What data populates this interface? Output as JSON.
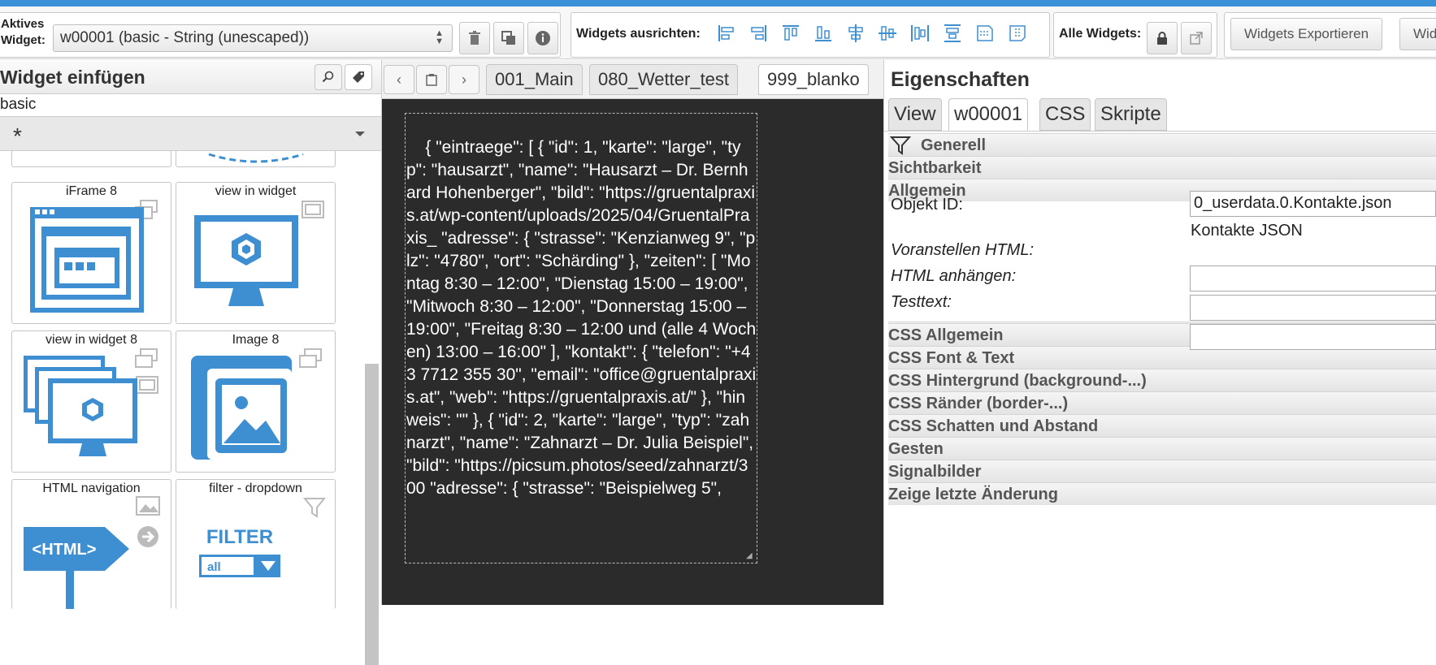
{
  "toolbar": {
    "active_widget_label_1": "Aktives",
    "active_widget_label_2": "Widget:",
    "active_widget_value": "w00001 (basic - String (unescaped))",
    "align_label": "Widgets ausrichten:",
    "all_widgets_label": "Alle Widgets:",
    "export_button": "Widgets Exportieren",
    "import_button": "Wid"
  },
  "left_panel": {
    "title": "Widget einfügen",
    "filter_value": "basic",
    "set_value": "*",
    "tiles": [
      {
        "name": "iFrame 8"
      },
      {
        "name": "view in widget"
      },
      {
        "name": "view in widget 8"
      },
      {
        "name": "Image 8"
      },
      {
        "name": "HTML navigation",
        "art_text": "<HTML>"
      },
      {
        "name": "filter - dropdown",
        "art_text": "FILTER",
        "art_sub": "all"
      }
    ]
  },
  "views": {
    "tabs": [
      "001_Main",
      "080_Wetter_test",
      "999_blanko"
    ],
    "active": "999_blanko"
  },
  "canvas": {
    "json_text": "{ \"eintraege\": [ { \"id\": 1, \"karte\": \"large\", \"typ\": \"hausarzt\", \"name\": \"Hausarzt – Dr. Bernhard Hohenberger\", \"bild\": \"https://gruentalpraxis.at/wp-content/uploads/2025/04/GruentalPraxis_ \"adresse\": { \"strasse\": \"Kenzianweg 9\", \"plz\": \"4780\", \"ort\": \"Schärding\" }, \"zeiten\": [ \"Montag 8:30 – 12:00\", \"Dienstag 15:00 – 19:00\", \"Mitwoch 8:30 – 12:00\", \"Donnerstag 15:00 – 19:00\", \"Freitag 8:30 – 12:00 und (alle 4 Wochen) 13:00 – 16:00\" ], \"kontakt\": { \"telefon\": \"+43 7712 355 30\", \"email\": \"office@gruentalpraxis.at\", \"web\": \"https://gruentalpraxis.at/\" }, \"hinweis\": \"\" }, { \"id\": 2, \"karte\": \"large\", \"typ\": \"zahnarzt\", \"name\": \"Zahnarzt – Dr. Julia Beispiel\", \"bild\": \"https://picsum.photos/seed/zahnarzt/300 \"adresse\": { \"strasse\": \"Beispielweg 5\","
  },
  "properties": {
    "title": "Eigenschaften",
    "tabs": [
      "View",
      "w00001",
      "CSS",
      "Skripte"
    ],
    "active_tab": "w00001",
    "groups_top": [
      "Generell",
      "Sichtbarkeit",
      "Allgemein"
    ],
    "fields": {
      "object_id_label": "Objekt ID:",
      "object_id_value": "0_userdata.0.Kontakte.json",
      "object_id_hint": "Kontakte JSON",
      "prepend_label": "Voranstellen HTML:",
      "append_label": "HTML anhängen:",
      "testtext_label": "Testtext:"
    },
    "groups_bottom": [
      "CSS Allgemein",
      "CSS Font & Text",
      "CSS Hintergrund (background-...)",
      "CSS Ränder (border-...)",
      "CSS Schatten und Abstand",
      "Gesten",
      "Signalbilder",
      "Zeige letzte Änderung"
    ]
  },
  "colors": {
    "accent": "#3a90d6",
    "canvas_bg": "#2b2b2b",
    "icon_blue": "#3d8fd2"
  }
}
